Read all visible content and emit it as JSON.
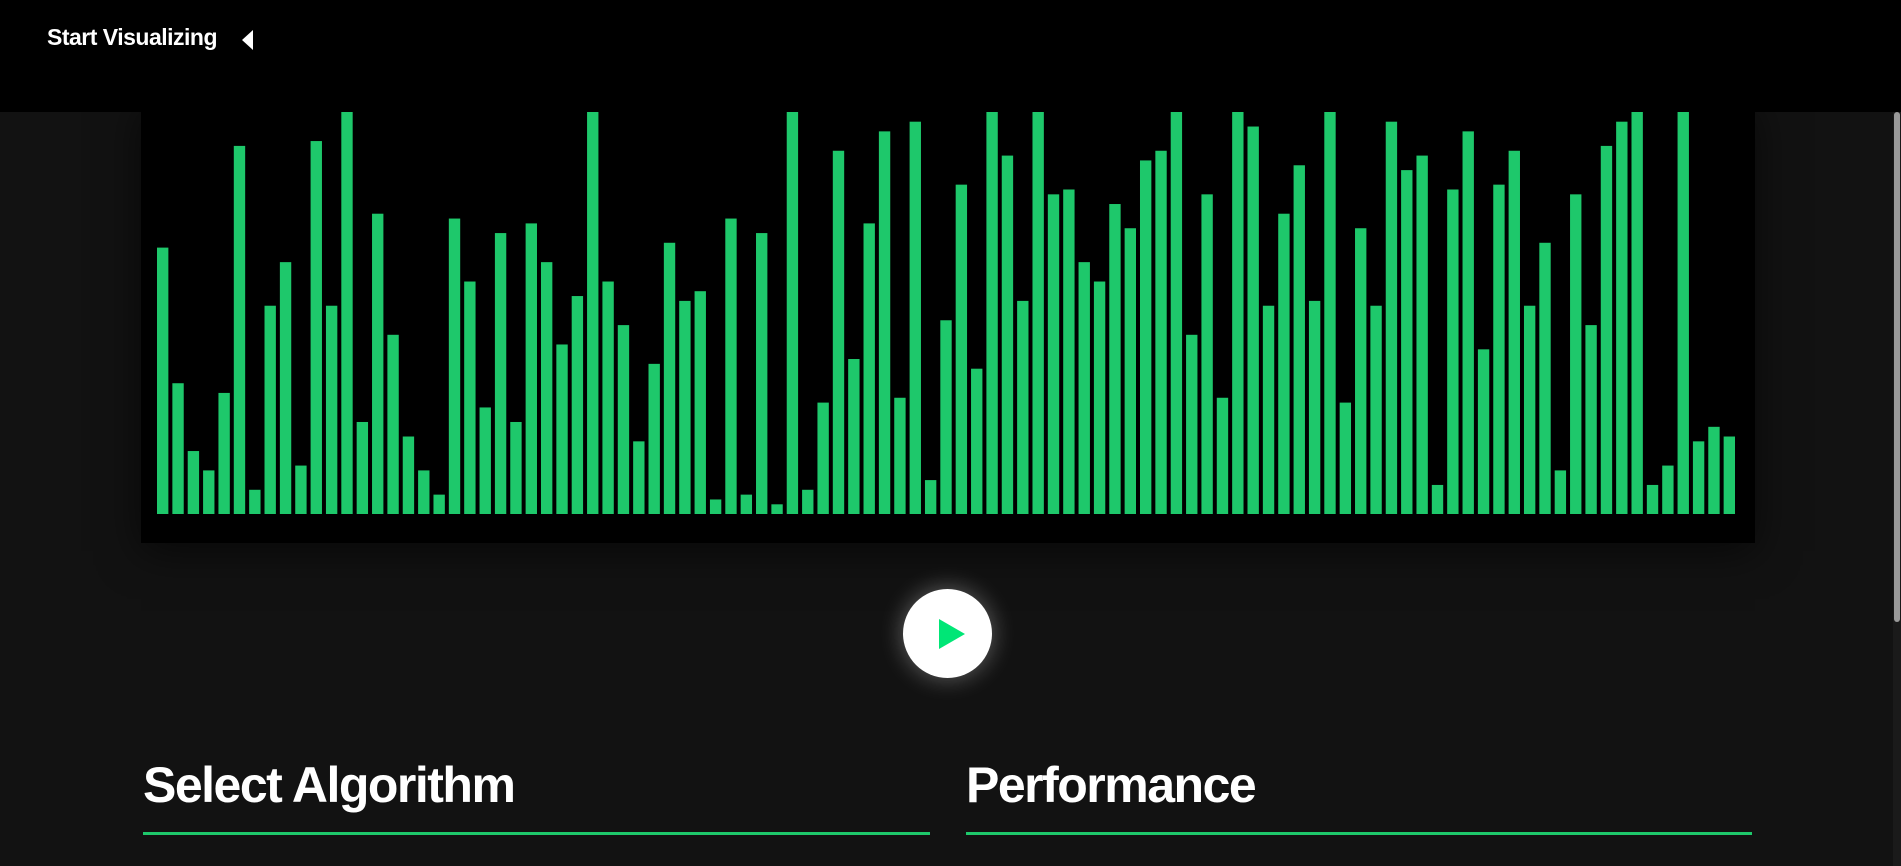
{
  "header": {
    "title": "Start Visualizing",
    "toggle_icon": "caret-left-icon"
  },
  "visualizer": {
    "bar_color": "#1ec86b",
    "bar_values": [
      55,
      27,
      13,
      9,
      25,
      76,
      5,
      43,
      52,
      10,
      77,
      43,
      83,
      19,
      62,
      37,
      16,
      9,
      4,
      61,
      48,
      22,
      58,
      19,
      60,
      52,
      35,
      45,
      83,
      48,
      39,
      15,
      31,
      56,
      44,
      46,
      3,
      61,
      4,
      58,
      2,
      83,
      5,
      23,
      75,
      32,
      60,
      79,
      24,
      81,
      7,
      40,
      68,
      30,
      83,
      74,
      44,
      83,
      66,
      67,
      52,
      48,
      64,
      59,
      73,
      75,
      83,
      37,
      66,
      24,
      83,
      80,
      43,
      62,
      72,
      44,
      83,
      23,
      59,
      43,
      81,
      71,
      74,
      6,
      67,
      79,
      34,
      68,
      75,
      43,
      56,
      9,
      66,
      39,
      76,
      81,
      83,
      6,
      10,
      83,
      15,
      18,
      16
    ],
    "max_value": 83
  },
  "play_button": {
    "icon": "play-icon",
    "icon_color": "#00e676"
  },
  "sections": {
    "select_algorithm": "Select Algorithm",
    "performance": "Performance",
    "rule_color": "#1ec86b"
  }
}
